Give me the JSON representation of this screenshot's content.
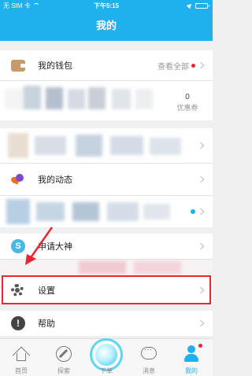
{
  "status_bar": {
    "carrier": "无 SIM 卡",
    "time": "下午5:15",
    "battery_level_percent": 100
  },
  "header": {
    "title": "我的"
  },
  "wallet": {
    "label": "我的钱包",
    "see_all": "查看全部",
    "coupon_count": "0",
    "coupon_label": "优惠券"
  },
  "menu": {
    "dynamics": "我的动态",
    "apply_god": "申请大神",
    "apply_god_icon_letter": "S",
    "settings": "设置",
    "help": "帮助"
  },
  "tabs": [
    {
      "label": "首页",
      "icon": "home-icon"
    },
    {
      "label": "探索",
      "icon": "compass-icon"
    },
    {
      "label": "下单",
      "icon": "order-icon"
    },
    {
      "label": "消息",
      "icon": "message-icon"
    },
    {
      "label": "我的",
      "icon": "profile-icon",
      "active": true
    }
  ],
  "colors": {
    "brand": "#1fb1ee",
    "highlight": "#e8262f"
  }
}
